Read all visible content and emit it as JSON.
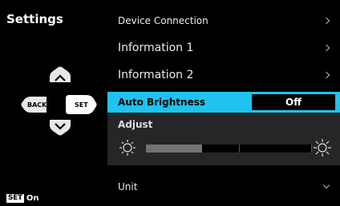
{
  "sidebar": {
    "title": "Settings"
  },
  "dpad": {
    "back_label": "BACK",
    "set_label": "SET"
  },
  "footer": {
    "set_badge": "SET",
    "state": "On"
  },
  "menu": {
    "items": [
      {
        "label": "Device Connection"
      },
      {
        "label": "Information 1"
      },
      {
        "label": "Information 2"
      }
    ],
    "selected": {
      "label": "Auto Brightness",
      "value": "Off"
    },
    "adjust": {
      "label": "Adjust",
      "level": 0.34
    },
    "unit": {
      "label": "Unit"
    }
  },
  "colors": {
    "highlight": "#1ec3ee",
    "panel": "#262626"
  }
}
